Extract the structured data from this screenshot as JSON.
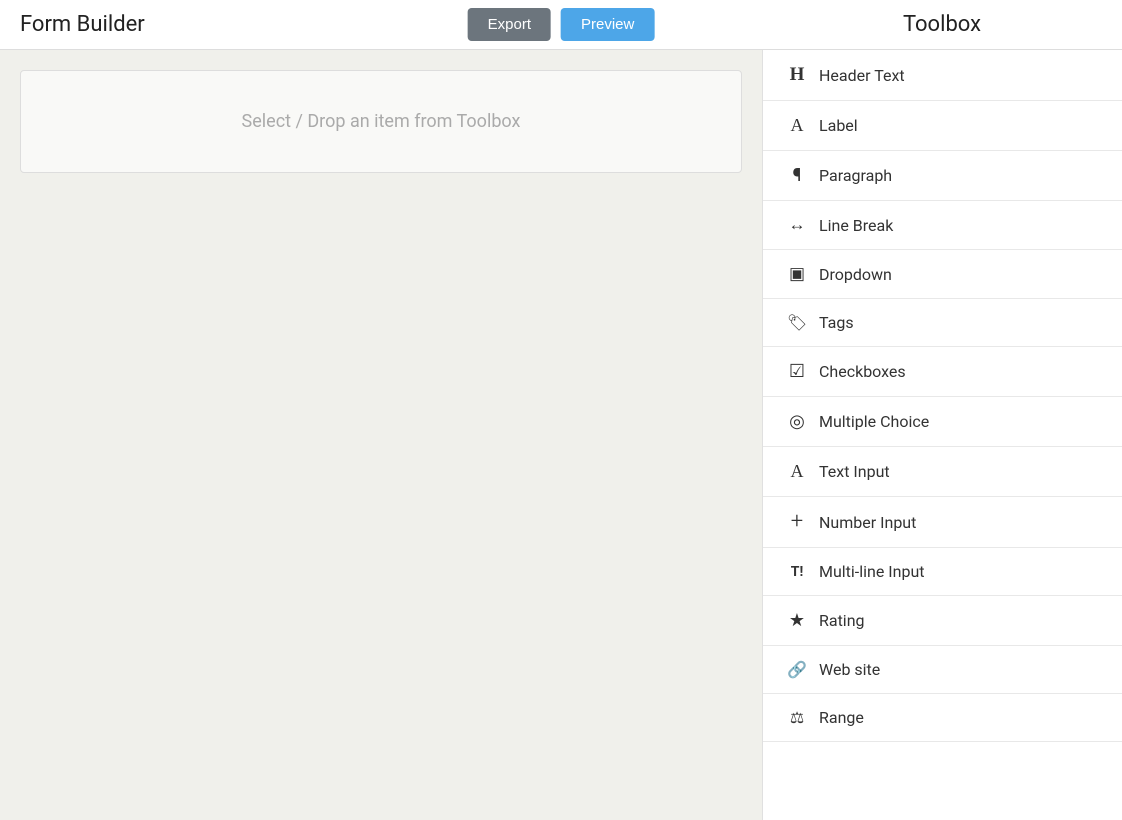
{
  "app": {
    "title": "Form Builder"
  },
  "header": {
    "export_label": "Export",
    "preview_label": "Preview",
    "toolbox_title": "Toolbox"
  },
  "canvas": {
    "drop_zone_text": "Select / Drop an item from Toolbox"
  },
  "toolbox": {
    "items": [
      {
        "id": "header-text",
        "label": "Header Text",
        "icon": "H",
        "icon_type": "header"
      },
      {
        "id": "label",
        "label": "Label",
        "icon": "A",
        "icon_type": "label"
      },
      {
        "id": "paragraph",
        "label": "Paragraph",
        "icon": "¶",
        "icon_type": "para"
      },
      {
        "id": "line-break",
        "label": "Line Break",
        "icon": "↔",
        "icon_type": "arrow"
      },
      {
        "id": "dropdown",
        "label": "Dropdown",
        "icon": "▣",
        "icon_type": "box"
      },
      {
        "id": "tags",
        "label": "Tags",
        "icon": "🏷",
        "icon_type": "tag"
      },
      {
        "id": "checkboxes",
        "label": "Checkboxes",
        "icon": "☑",
        "icon_type": "check"
      },
      {
        "id": "multiple-choice",
        "label": "Multiple Choice",
        "icon": "◎",
        "icon_type": "radio"
      },
      {
        "id": "text-input",
        "label": "Text Input",
        "icon": "A",
        "icon_type": "text-input"
      },
      {
        "id": "number-input",
        "label": "Number Input",
        "icon": "+",
        "icon_type": "plus"
      },
      {
        "id": "multi-line-input",
        "label": "Multi-line Input",
        "icon": "T¹",
        "icon_type": "multiline"
      },
      {
        "id": "rating",
        "label": "Rating",
        "icon": "★",
        "icon_type": "star"
      },
      {
        "id": "web-site",
        "label": "Web site",
        "icon": "⛓",
        "icon_type": "link"
      },
      {
        "id": "range",
        "label": "Range",
        "icon": "⚖",
        "icon_type": "range"
      }
    ]
  }
}
